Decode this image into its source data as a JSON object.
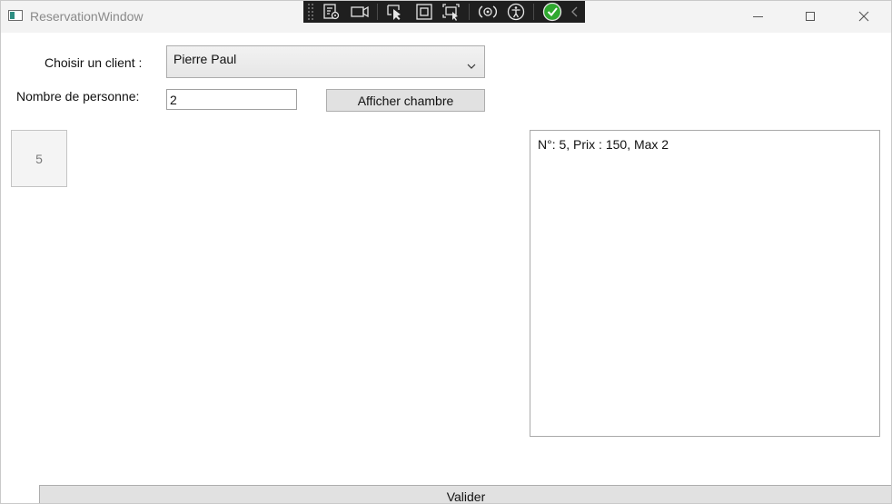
{
  "window": {
    "title": "ReservationWindow"
  },
  "titlebar": {
    "icons": [
      "app-window-icon",
      "minimize-icon",
      "maximize-icon",
      "close-icon"
    ]
  },
  "debug_toolbar": {
    "icons": [
      "toolbar-grip-icon",
      "live-visual-tree-icon",
      "camera-icon",
      "select-element-icon",
      "display-layout-adorners-icon",
      "track-focus-icon",
      "hot-reload-icon",
      "accessibility-icon",
      "binding-check-icon",
      "collapse-chevron-icon"
    ]
  },
  "form": {
    "client_label": "Choisir un client :",
    "client_selected": "Pierre Paul",
    "nombre_label": "Nombre de personne:",
    "nombre_value": "2",
    "afficher_button": "Afficher chambre"
  },
  "rooms": [
    {
      "label": "5"
    }
  ],
  "details": {
    "items": [
      "N°: 5, Prix : 150, Max 2"
    ]
  },
  "footer": {
    "valider_button": "Valider"
  },
  "colors": {
    "titlebar_bg": "#f3f3f3",
    "toolbar_bg": "#1f1f1f",
    "button_bg": "#e1e1e1",
    "check_green": "#2fa82f"
  }
}
